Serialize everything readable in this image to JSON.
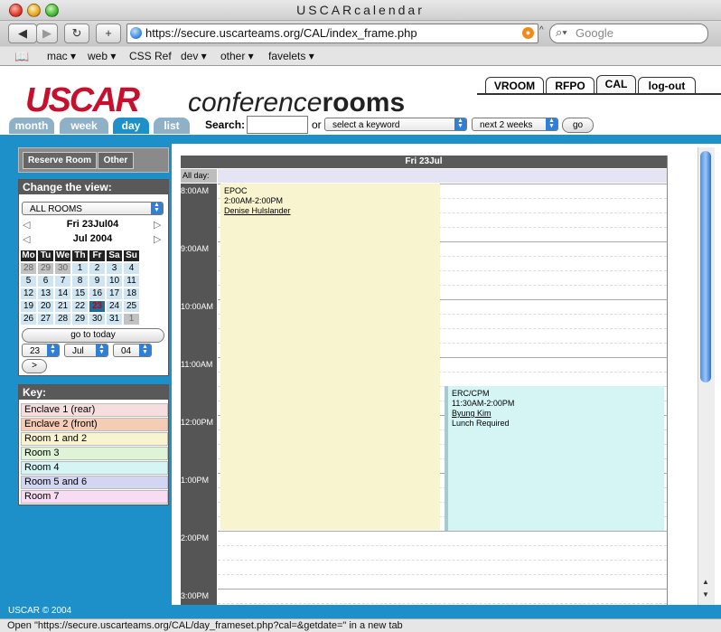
{
  "window": {
    "title": "USCARcalendar"
  },
  "toolbar": {
    "url": "https://secure.uscarteams.org/CAL/index_frame.php",
    "search_placeholder": "Google"
  },
  "bookmarks": [
    "mac ▾",
    "web ▾",
    "CSS Ref",
    "dev ▾",
    "other ▾",
    "favelets ▾"
  ],
  "logo": {
    "brand": "USCAR",
    "word1": "conference",
    "word2": "rooms"
  },
  "top_tabs": [
    "VROOM",
    "RFPO",
    "CAL",
    "log-out"
  ],
  "nav_tabs": [
    "month",
    "week",
    "day",
    "list"
  ],
  "search": {
    "label": "Search:",
    "or": "or",
    "keyword": "select a keyword",
    "range": "next 2 weeks",
    "go": "go"
  },
  "sidebar": {
    "reserve": "Reserve Room",
    "other": "Other",
    "change_view": "Change the view:",
    "room_select": "ALL ROOMS",
    "date_label": "Fri 23Jul04",
    "month_label": "Jul 2004",
    "weekdays": [
      "Mo",
      "Tu",
      "We",
      "Th",
      "Fr",
      "Sa",
      "Su"
    ],
    "weeks": [
      [
        "28",
        "29",
        "30",
        "1",
        "2",
        "3",
        "4"
      ],
      [
        "5",
        "6",
        "7",
        "8",
        "9",
        "10",
        "11"
      ],
      [
        "12",
        "13",
        "14",
        "15",
        "16",
        "17",
        "18"
      ],
      [
        "19",
        "20",
        "21",
        "22",
        "23",
        "24",
        "25"
      ],
      [
        "26",
        "27",
        "28",
        "29",
        "30",
        "31",
        "1"
      ]
    ],
    "goto_today": "go to today",
    "day_sel": "23",
    "month_sel": "Jul",
    "year_sel": "04",
    "next_btn": ">",
    "key_title": "Key:",
    "key_items": [
      {
        "label": "Enclave 1 (rear)",
        "color": "#f7dede"
      },
      {
        "label": "Enclave 2 (front)",
        "color": "#f5ccb5"
      },
      {
        "label": "Room 1 and 2",
        "color": "#f8f4cf"
      },
      {
        "label": "Room 3",
        "color": "#dff3d6"
      },
      {
        "label": "Room 4",
        "color": "#d5f5f5"
      },
      {
        "label": "Room 5 and 6",
        "color": "#d3d6f3"
      },
      {
        "label": "Room 7",
        "color": "#f8dcf3"
      }
    ]
  },
  "dayview": {
    "header": "Fri 23Jul",
    "allday": "All day:",
    "hours": [
      "8:00AM",
      "9:00AM",
      "10:00AM",
      "11:00AM",
      "12:00PM",
      "1:00PM",
      "2:00PM",
      "3:00PM"
    ],
    "events": [
      {
        "title": "EPOC",
        "time": "2:00AM-2:00PM",
        "person": "Denise Hulslander",
        "note": "",
        "color": "#f8f4cf"
      },
      {
        "title": "ERC/CPM",
        "time": "11:30AM-2:00PM",
        "person": "Byung Kim",
        "note": "Lunch Required",
        "color": "#d5f5f5"
      }
    ]
  },
  "footer": {
    "copyright": "USCAR © 2004"
  },
  "status": "Open \"https://secure.uscarteams.org/CAL/day_frameset.php?cal=&getdate=\" in a new tab"
}
